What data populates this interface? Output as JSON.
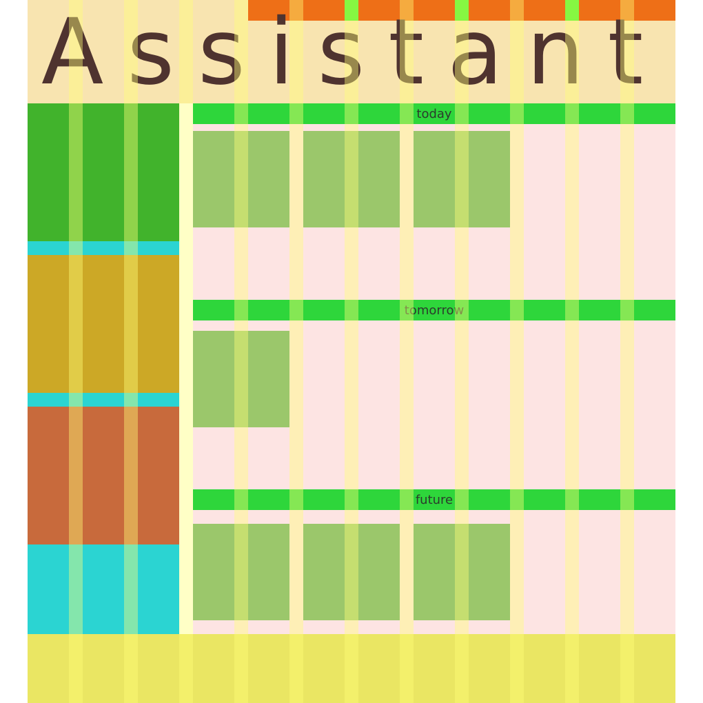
{
  "app": {
    "title": "Assistant"
  },
  "sections": [
    {
      "label": "today",
      "item_count": 3
    },
    {
      "label": "tomorrow",
      "item_count": 1
    },
    {
      "label": "future",
      "item_count": 3
    }
  ],
  "colors": {
    "header_bg": "#f8e4b0",
    "title_text": "#4f332f",
    "top_bar": "#ee6f17",
    "top_bar_accent": "#2ff11c",
    "section_bar": "#2ed63b",
    "card": "#9bc76b",
    "main_bg": "#fde4e3",
    "left_green": "#41b32c",
    "left_mustard": "#cca826",
    "left_rust": "#c86a3c",
    "left_cyan": "#2bd4d2",
    "footer": "#eae663"
  }
}
